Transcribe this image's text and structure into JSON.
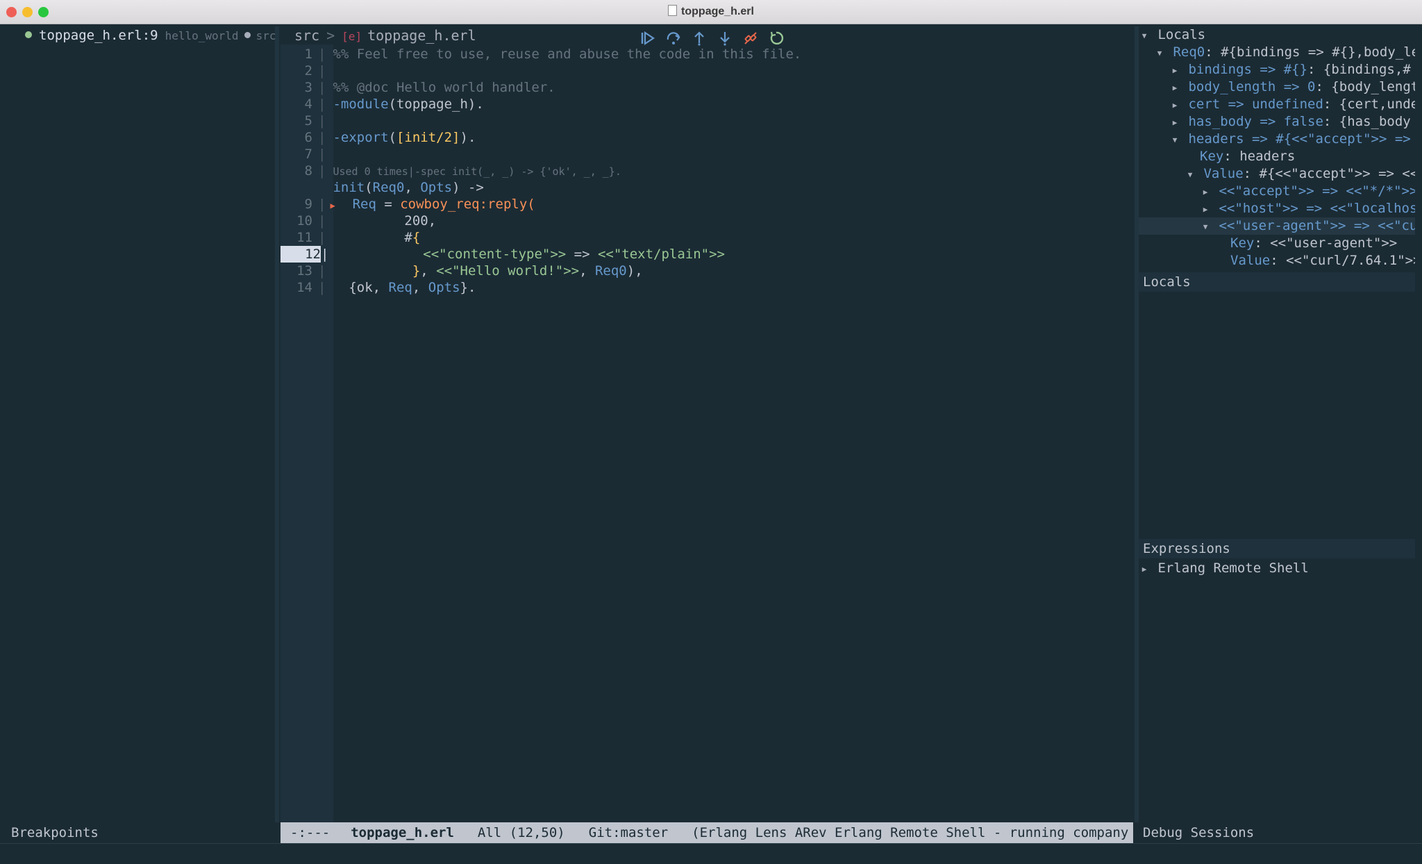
{
  "window": {
    "title": "toppage_h.erl"
  },
  "tabline": {
    "file": "toppage_h.erl:9",
    "project": "hello_world",
    "src_fragment": "src"
  },
  "breadcrumb": {
    "dir": "src",
    "sep": ">",
    "icon_text": "[e]",
    "file": "toppage_h.erl"
  },
  "toolbar": {
    "buttons": [
      {
        "name": "continue-icon",
        "color": "#6699cc"
      },
      {
        "name": "step-over-icon",
        "color": "#6699cc"
      },
      {
        "name": "step-out-icon",
        "color": "#6699cc"
      },
      {
        "name": "step-in-icon",
        "color": "#6699cc"
      },
      {
        "name": "disconnect-icon",
        "color": "#e8674b"
      },
      {
        "name": "restart-icon",
        "color": "#99c794"
      }
    ]
  },
  "editor": {
    "lines": {
      "l1": {
        "num": "1",
        "comment": "%% Feel free to use, reuse and abuse the code in this file."
      },
      "l2": {
        "num": "2"
      },
      "l3": {
        "num": "3",
        "comment": "%% @doc Hello world handler."
      },
      "l4": {
        "num": "4",
        "kw": "-module",
        "rest": "(toppage_h)."
      },
      "l5": {
        "num": "5"
      },
      "l6": {
        "num": "6",
        "kw": "-export",
        "open": "(",
        "bracket": "[init/2]",
        "close": ")."
      },
      "l7": {
        "num": "7"
      },
      "l8": {
        "num": "8",
        "lens": "Used 0 times|-spec init(_, _) -> {'ok', _, _}."
      },
      "l8b": {
        "fn": "init",
        "open": "(",
        "a1": "Req0",
        "comma": ", ",
        "a2": "Opts",
        "close": ") ->"
      },
      "l9": {
        "num": "9",
        "var": "Req",
        "eq": " = ",
        "call": "cowboy_req:reply("
      },
      "l10": {
        "num": "10",
        "text": "200,"
      },
      "l11": {
        "num": "11",
        "hash": "#",
        "brace": "{"
      },
      "l12": {
        "num": "12",
        "s1": "<<\"content-type\">>",
        "arrow": " => ",
        "s2": "<<\"text/plain\">>"
      },
      "l13": {
        "num": "13",
        "brace": "}",
        "comma": ", ",
        "s1": "<<\"Hello world!\">>",
        "comma2": ", ",
        "var": "Req0",
        "close": "),"
      },
      "l14": {
        "num": "14",
        "open": "{ok, ",
        "v1": "Req",
        "comma": ", ",
        "v2": "Opts",
        "close": "}."
      }
    }
  },
  "modeline": {
    "state": "-:---",
    "file": "toppage_h.erl",
    "position": "All (12,50)",
    "git": "Git:master",
    "modes": "(Erlang Lens ARev Erlang Remote Shell - running company WK"
  },
  "left_footer": {
    "label": "Breakpoints"
  },
  "right_footer": {
    "label": "Debug Sessions"
  },
  "locals_tree": {
    "title": "Locals",
    "rows": [
      {
        "key": "Req0",
        "val": ": #{bindings => #{},body_le"
      },
      {
        "key": "bindings => #{}",
        "val": ": {bindings,#"
      },
      {
        "key": "body_length => 0",
        "val": ": {body_lengt"
      },
      {
        "key": "cert => undefined",
        "val": ": {cert,unde"
      },
      {
        "key": "has_body => false",
        "val": ": {has_body"
      },
      {
        "key": "headers => #{<<\"accept\">> =>",
        "val": ""
      },
      {
        "key": "Key",
        "val": ": headers"
      },
      {
        "key": "Value",
        "val": ": #{<<\"accept\">> => <<"
      },
      {
        "key": "<<\"accept\">> => <<\"*/*\">>",
        "val": ":"
      },
      {
        "key": "<<\"host\">> => <<\"localhos",
        "val": ""
      },
      {
        "key": "<<\"user-agent\">> => <<\"cu",
        "val": ""
      },
      {
        "key": "Key",
        "val": ": <<\"user-agent\">>"
      },
      {
        "key": "Value",
        "val": ": <<\"curl/7.64.1\">>"
      }
    ]
  },
  "locals_section": {
    "title": "Locals"
  },
  "expressions_section": {
    "title": "Expressions",
    "items": [
      {
        "label": "Erlang Remote Shell"
      }
    ]
  }
}
